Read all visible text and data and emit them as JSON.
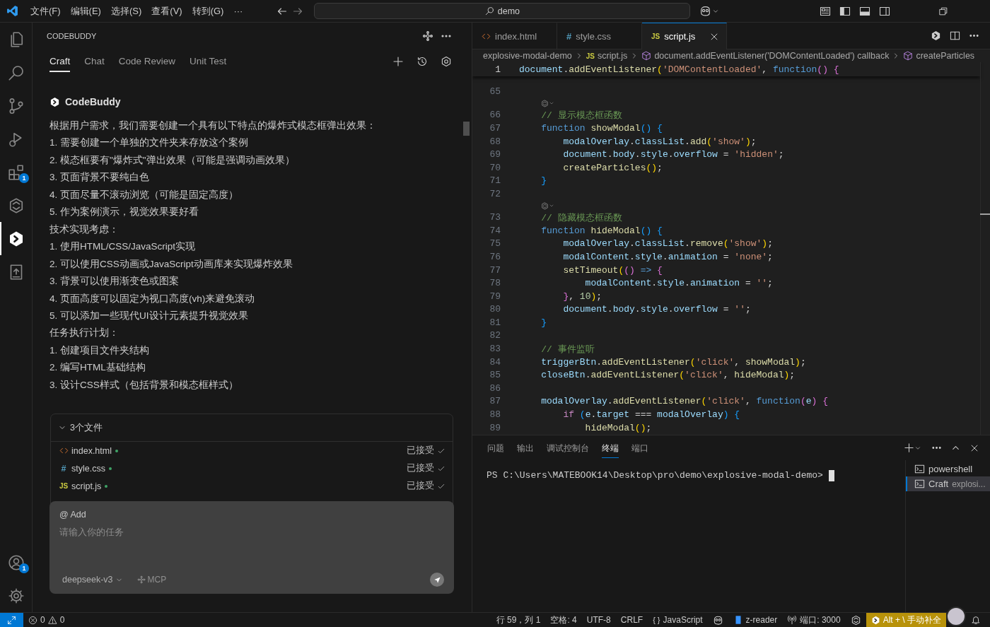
{
  "title_bar": {
    "menus": [
      "文件(F)",
      "编辑(E)",
      "选择(S)",
      "查看(V)",
      "转到(G)",
      "···"
    ],
    "search": {
      "value": "demo"
    }
  },
  "activity_bar": {
    "items": [
      {
        "selected": false
      },
      {
        "selected": false
      },
      {
        "selected": false
      },
      {
        "selected": false
      },
      {
        "selected": false,
        "badge": "1"
      },
      {
        "selected": false
      },
      {
        "selected": true
      },
      {
        "selected": false
      }
    ],
    "account_badge": "1"
  },
  "side_panel": {
    "title": "CODEBUDDY",
    "tabs": [
      {
        "label": "Craft",
        "selected": true
      },
      {
        "label": "Chat",
        "selected": false
      },
      {
        "label": "Code Review",
        "selected": false
      },
      {
        "label": "Unit Test",
        "selected": false
      }
    ],
    "message": {
      "author": "CodeBuddy",
      "lines": [
        "根据用户需求，我们需要创建一个具有以下特点的爆炸式模态框弹出效果：",
        "1. 需要创建一个单独的文件夹来存放这个案例",
        "2. 模态框要有\"爆炸式\"弹出效果（可能是强调动画效果）",
        "3. 页面背景不要纯白色",
        "4. 页面尽量不滚动浏览（可能是固定高度）",
        "5. 作为案例演示，视觉效果要好看",
        "技术实现考虑：",
        "1. 使用HTML/CSS/JavaScript实现",
        "2. 可以使用CSS动画或JavaScript动画库来实现爆炸效果",
        "3. 背景可以使用渐变色或图案",
        "4. 页面高度可以固定为视口高度(vh)来避免滚动",
        "5. 可以添加一些现代UI设计元素提升视觉效果",
        "任务执行计划：",
        "1. 创建项目文件夹结构",
        "2. 编写HTML基础结构",
        "3. 设计CSS样式（包括背景和模态框样式）"
      ]
    },
    "files_card": {
      "title": "3个文件",
      "expanded": true,
      "files": [
        {
          "kind": "html",
          "name": "index.html",
          "status": "已接受"
        },
        {
          "kind": "css",
          "glyph": "#",
          "name": "style.css",
          "status": "已接受"
        },
        {
          "kind": "js",
          "glyph": "JS",
          "name": "script.js",
          "status": "已接受"
        }
      ]
    },
    "composer": {
      "mention": "@ Add",
      "placeholder": "请输入你的任务",
      "model": "deepseek-v3",
      "mcp": "MCP"
    }
  },
  "editor": {
    "tabs": [
      {
        "kind": "html",
        "name": "index.html",
        "selected": false
      },
      {
        "kind": "css",
        "glyph": "#",
        "name": "style.css",
        "selected": false
      },
      {
        "kind": "js",
        "glyph": "JS",
        "name": "script.js",
        "selected": true
      }
    ],
    "breadcrumbs": [
      {
        "kind": "folder",
        "text": "explosive-modal-demo"
      },
      {
        "kind": "file",
        "glyph": "JS",
        "text": "script.js"
      },
      {
        "kind": "symbol",
        "text": "document.addEventListener('DOMContentLoaded') callback"
      },
      {
        "kind": "symbol",
        "text": "createParticles"
      }
    ],
    "sticky_line": {
      "number": "1",
      "tokens": [
        {
          "text": "document",
          "kind": "v"
        },
        {
          "text": ".",
          "kind": "p"
        },
        {
          "text": "addEventListener",
          "kind": "f"
        },
        {
          "text": "(",
          "kind": "b1"
        },
        {
          "text": "'DOMContentLoaded'",
          "kind": "s"
        },
        {
          "text": ", ",
          "kind": "p"
        },
        {
          "text": "function",
          "kind": "k"
        },
        {
          "text": "() {",
          "kind": "b2"
        }
      ]
    },
    "lines": [
      {
        "kind": "line",
        "number": "65"
      },
      {
        "kind": "codelens"
      },
      {
        "kind": "line",
        "number": "66",
        "tokens": [
          {
            "text": "    // 显示模态框函数",
            "kind": "c"
          }
        ]
      },
      {
        "kind": "line",
        "number": "67",
        "tokens": [
          {
            "text": "    function ",
            "kind": "k"
          },
          {
            "text": "showModal",
            "kind": "f"
          },
          {
            "text": "() {",
            "kind": "b3"
          }
        ]
      },
      {
        "kind": "line",
        "number": "68",
        "tokens": [
          {
            "text": "        modalOverlay",
            "kind": "v"
          },
          {
            "text": ".",
            "kind": "p"
          },
          {
            "text": "classList",
            "kind": "v"
          },
          {
            "text": ".",
            "kind": "p"
          },
          {
            "text": "add",
            "kind": "f"
          },
          {
            "text": "(",
            "kind": "b1"
          },
          {
            "text": "'show'",
            "kind": "s"
          },
          {
            "text": ")",
            "kind": "b1"
          },
          {
            "text": ";",
            "kind": "p"
          }
        ]
      },
      {
        "kind": "line",
        "number": "69",
        "tokens": [
          {
            "text": "        document",
            "kind": "v"
          },
          {
            "text": ".",
            "kind": "p"
          },
          {
            "text": "body",
            "kind": "v"
          },
          {
            "text": ".",
            "kind": "p"
          },
          {
            "text": "style",
            "kind": "v"
          },
          {
            "text": ".",
            "kind": "p"
          },
          {
            "text": "overflow",
            "kind": "v"
          },
          {
            "text": " = ",
            "kind": "p"
          },
          {
            "text": "'hidden'",
            "kind": "s"
          },
          {
            "text": ";",
            "kind": "p"
          }
        ]
      },
      {
        "kind": "line",
        "number": "70",
        "tokens": [
          {
            "text": "        createParticles",
            "kind": "f"
          },
          {
            "text": "()",
            "kind": "b1"
          },
          {
            "text": ";",
            "kind": "p"
          }
        ]
      },
      {
        "kind": "line",
        "number": "71",
        "tokens": [
          {
            "text": "    }",
            "kind": "b3"
          }
        ]
      },
      {
        "kind": "line",
        "number": "72"
      },
      {
        "kind": "codelens"
      },
      {
        "kind": "line",
        "number": "73",
        "tokens": [
          {
            "text": "    // 隐藏模态框函数",
            "kind": "c"
          }
        ]
      },
      {
        "kind": "line",
        "number": "74",
        "tokens": [
          {
            "text": "    function ",
            "kind": "k"
          },
          {
            "text": "hideModal",
            "kind": "f"
          },
          {
            "text": "() {",
            "kind": "b3"
          }
        ]
      },
      {
        "kind": "line",
        "number": "75",
        "tokens": [
          {
            "text": "        modalOverlay",
            "kind": "v"
          },
          {
            "text": ".",
            "kind": "p"
          },
          {
            "text": "classList",
            "kind": "v"
          },
          {
            "text": ".",
            "kind": "p"
          },
          {
            "text": "remove",
            "kind": "f"
          },
          {
            "text": "(",
            "kind": "b1"
          },
          {
            "text": "'show'",
            "kind": "s"
          },
          {
            "text": ")",
            "kind": "b1"
          },
          {
            "text": ";",
            "kind": "p"
          }
        ]
      },
      {
        "kind": "line",
        "number": "76",
        "tokens": [
          {
            "text": "        modalContent",
            "kind": "v"
          },
          {
            "text": ".",
            "kind": "p"
          },
          {
            "text": "style",
            "kind": "v"
          },
          {
            "text": ".",
            "kind": "p"
          },
          {
            "text": "animation",
            "kind": "v"
          },
          {
            "text": " = ",
            "kind": "p"
          },
          {
            "text": "'none'",
            "kind": "s"
          },
          {
            "text": ";",
            "kind": "p"
          }
        ]
      },
      {
        "kind": "line",
        "number": "77",
        "tokens": [
          {
            "text": "        setTimeout",
            "kind": "f"
          },
          {
            "text": "(",
            "kind": "b1"
          },
          {
            "text": "()",
            "kind": "b2"
          },
          {
            "text": " => ",
            "kind": "k"
          },
          {
            "text": "{",
            "kind": "b2"
          }
        ]
      },
      {
        "kind": "line",
        "number": "78",
        "tokens": [
          {
            "text": "            modalContent",
            "kind": "v"
          },
          {
            "text": ".",
            "kind": "p"
          },
          {
            "text": "style",
            "kind": "v"
          },
          {
            "text": ".",
            "kind": "p"
          },
          {
            "text": "animation",
            "kind": "v"
          },
          {
            "text": " = ",
            "kind": "p"
          },
          {
            "text": "''",
            "kind": "s"
          },
          {
            "text": ";",
            "kind": "p"
          }
        ]
      },
      {
        "kind": "line",
        "number": "79",
        "tokens": [
          {
            "text": "        }",
            "kind": "b2"
          },
          {
            "text": ", ",
            "kind": "p"
          },
          {
            "text": "10",
            "kind": "n"
          },
          {
            "text": ")",
            "kind": "b1"
          },
          {
            "text": ";",
            "kind": "p"
          }
        ]
      },
      {
        "kind": "line",
        "number": "80",
        "tokens": [
          {
            "text": "        document",
            "kind": "v"
          },
          {
            "text": ".",
            "kind": "p"
          },
          {
            "text": "body",
            "kind": "v"
          },
          {
            "text": ".",
            "kind": "p"
          },
          {
            "text": "style",
            "kind": "v"
          },
          {
            "text": ".",
            "kind": "p"
          },
          {
            "text": "overflow",
            "kind": "v"
          },
          {
            "text": " = ",
            "kind": "p"
          },
          {
            "text": "''",
            "kind": "s"
          },
          {
            "text": ";",
            "kind": "p"
          }
        ]
      },
      {
        "kind": "line",
        "number": "81",
        "tokens": [
          {
            "text": "    }",
            "kind": "b3"
          }
        ]
      },
      {
        "kind": "line",
        "number": "82"
      },
      {
        "kind": "line",
        "number": "83",
        "tokens": [
          {
            "text": "    // 事件监听",
            "kind": "c"
          }
        ]
      },
      {
        "kind": "line",
        "number": "84",
        "tokens": [
          {
            "text": "    triggerBtn",
            "kind": "v"
          },
          {
            "text": ".",
            "kind": "p"
          },
          {
            "text": "addEventListener",
            "kind": "f"
          },
          {
            "text": "(",
            "kind": "b1"
          },
          {
            "text": "'click'",
            "kind": "s"
          },
          {
            "text": ", ",
            "kind": "p"
          },
          {
            "text": "showModal",
            "kind": "f"
          },
          {
            "text": ")",
            "kind": "b1"
          },
          {
            "text": ";",
            "kind": "p"
          }
        ]
      },
      {
        "kind": "line",
        "number": "85",
        "tokens": [
          {
            "text": "    closeBtn",
            "kind": "v"
          },
          {
            "text": ".",
            "kind": "p"
          },
          {
            "text": "addEventListener",
            "kind": "f"
          },
          {
            "text": "(",
            "kind": "b1"
          },
          {
            "text": "'click'",
            "kind": "s"
          },
          {
            "text": ", ",
            "kind": "p"
          },
          {
            "text": "hideModal",
            "kind": "f"
          },
          {
            "text": ")",
            "kind": "b1"
          },
          {
            "text": ";",
            "kind": "p"
          }
        ]
      },
      {
        "kind": "line",
        "number": "86"
      },
      {
        "kind": "line",
        "number": "87",
        "tokens": [
          {
            "text": "    modalOverlay",
            "kind": "v"
          },
          {
            "text": ".",
            "kind": "p"
          },
          {
            "text": "addEventListener",
            "kind": "f"
          },
          {
            "text": "(",
            "kind": "b1"
          },
          {
            "text": "'click'",
            "kind": "s"
          },
          {
            "text": ", ",
            "kind": "p"
          },
          {
            "text": "function",
            "kind": "k"
          },
          {
            "text": "(",
            "kind": "b2"
          },
          {
            "text": "e",
            "kind": "v"
          },
          {
            "text": ") {",
            "kind": "b2"
          }
        ]
      },
      {
        "kind": "line",
        "number": "88",
        "tokens": [
          {
            "text": "        if ",
            "kind": "kc"
          },
          {
            "text": "(",
            "kind": "b3"
          },
          {
            "text": "e",
            "kind": "v"
          },
          {
            "text": ".",
            "kind": "p"
          },
          {
            "text": "target",
            "kind": "v"
          },
          {
            "text": " === ",
            "kind": "p"
          },
          {
            "text": "modalOverlay",
            "kind": "v"
          },
          {
            "text": ") {",
            "kind": "b3"
          }
        ]
      },
      {
        "kind": "line",
        "number": "89",
        "tokens": [
          {
            "text": "            hideModal",
            "kind": "f"
          },
          {
            "text": "()",
            "kind": "b1"
          },
          {
            "text": ";",
            "kind": "p"
          }
        ]
      }
    ]
  },
  "panel": {
    "tabs": [
      {
        "label": "问题",
        "selected": false
      },
      {
        "label": "输出",
        "selected": false
      },
      {
        "label": "调试控制台",
        "selected": false
      },
      {
        "label": "终端",
        "selected": true
      },
      {
        "label": "端口",
        "selected": false
      }
    ],
    "terminal": {
      "prompt": "PS C:\\Users\\MATEBOOK14\\Desktop\\pro\\demo\\explosive-modal-demo>"
    },
    "terminals": [
      {
        "name": "powershell",
        "selected": false
      },
      {
        "name": "Craft",
        "detail": "explosi...",
        "selected": true
      }
    ]
  },
  "status_bar": {
    "errors": "0",
    "warnings": "0",
    "items": [
      {
        "kind": "text",
        "text": "行 59，列 1"
      },
      {
        "kind": "text",
        "text": "空格: 4"
      },
      {
        "kind": "text",
        "text": "UTF-8"
      },
      {
        "kind": "text",
        "text": "CRLF"
      },
      {
        "kind": "language",
        "glyph": "{ }",
        "text": "JavaScript"
      },
      {
        "kind": "robot"
      },
      {
        "kind": "book",
        "text": "z-reader"
      },
      {
        "kind": "port",
        "text": "端口: 3000"
      },
      {
        "kind": "hexagon"
      },
      {
        "kind": "completion",
        "text": "Alt + \\ 手动补全"
      },
      {
        "kind": "avatar"
      },
      {
        "kind": "bell"
      }
    ]
  }
}
